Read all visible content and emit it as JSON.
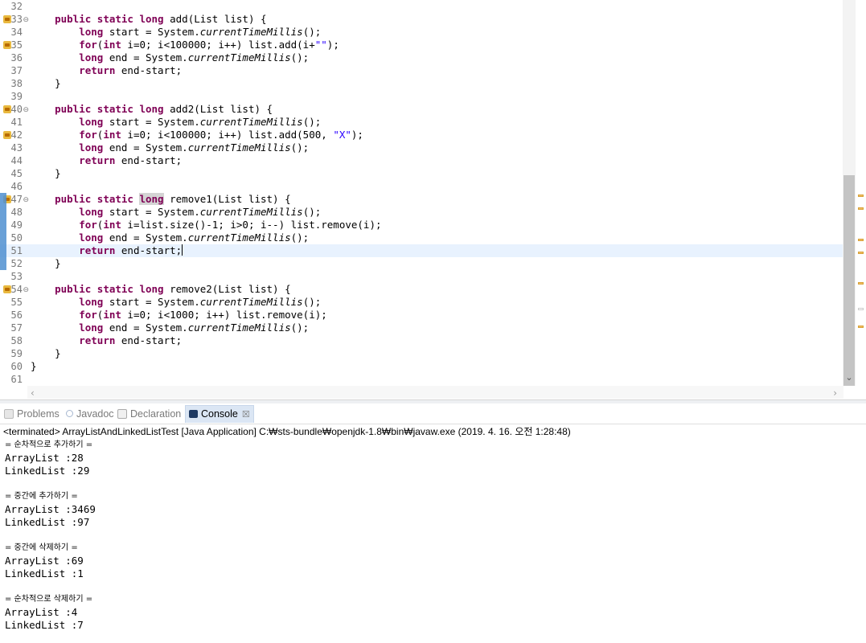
{
  "editor": {
    "lines": [
      {
        "num": "32",
        "seg": []
      },
      {
        "num": "33",
        "seg": [
          [
            "    ",
            ""
          ],
          [
            "public",
            "kw"
          ],
          [
            " ",
            ""
          ],
          [
            "static",
            "kw"
          ],
          [
            " ",
            ""
          ],
          [
            "long",
            "kw"
          ],
          [
            " add(List list) {",
            ""
          ]
        ]
      },
      {
        "num": "34",
        "seg": [
          [
            "        ",
            ""
          ],
          [
            "long",
            "kw"
          ],
          [
            " start = System.",
            ""
          ],
          [
            "currentTimeMillis",
            "ital"
          ],
          [
            "();",
            ""
          ]
        ]
      },
      {
        "num": "35",
        "seg": [
          [
            "        ",
            ""
          ],
          [
            "for",
            "kw"
          ],
          [
            "(",
            ""
          ],
          [
            "int",
            "kw"
          ],
          [
            " i=0; i<100000; i++) list.add(i+",
            ""
          ],
          [
            "\"\"",
            "str"
          ],
          [
            ");",
            ""
          ]
        ]
      },
      {
        "num": "36",
        "seg": [
          [
            "        ",
            ""
          ],
          [
            "long",
            "kw"
          ],
          [
            " end = System.",
            ""
          ],
          [
            "currentTimeMillis",
            "ital"
          ],
          [
            "();",
            ""
          ]
        ]
      },
      {
        "num": "37",
        "seg": [
          [
            "        ",
            ""
          ],
          [
            "return",
            "kw"
          ],
          [
            " end-start;",
            ""
          ]
        ]
      },
      {
        "num": "38",
        "seg": [
          [
            "    }",
            ""
          ]
        ]
      },
      {
        "num": "39",
        "seg": []
      },
      {
        "num": "40",
        "seg": [
          [
            "    ",
            ""
          ],
          [
            "public",
            "kw"
          ],
          [
            " ",
            ""
          ],
          [
            "static",
            "kw"
          ],
          [
            " ",
            ""
          ],
          [
            "long",
            "kw"
          ],
          [
            " add2(List list) {",
            ""
          ]
        ]
      },
      {
        "num": "41",
        "seg": [
          [
            "        ",
            ""
          ],
          [
            "long",
            "kw"
          ],
          [
            " start = System.",
            ""
          ],
          [
            "currentTimeMillis",
            "ital"
          ],
          [
            "();",
            ""
          ]
        ]
      },
      {
        "num": "42",
        "seg": [
          [
            "        ",
            ""
          ],
          [
            "for",
            "kw"
          ],
          [
            "(",
            ""
          ],
          [
            "int",
            "kw"
          ],
          [
            " i=0; i<100000; i++) list.add(500, ",
            ""
          ],
          [
            "\"X\"",
            "str"
          ],
          [
            ");",
            ""
          ]
        ]
      },
      {
        "num": "43",
        "seg": [
          [
            "        ",
            ""
          ],
          [
            "long",
            "kw"
          ],
          [
            " end = System.",
            ""
          ],
          [
            "currentTimeMillis",
            "ital"
          ],
          [
            "();",
            ""
          ]
        ]
      },
      {
        "num": "44",
        "seg": [
          [
            "        ",
            ""
          ],
          [
            "return",
            "kw"
          ],
          [
            " end-start;",
            ""
          ]
        ]
      },
      {
        "num": "45",
        "seg": [
          [
            "    }",
            ""
          ]
        ]
      },
      {
        "num": "46",
        "seg": []
      },
      {
        "num": "47",
        "seg": [
          [
            "    ",
            ""
          ],
          [
            "public",
            "kw"
          ],
          [
            " ",
            ""
          ],
          [
            "static",
            "kw"
          ],
          [
            " ",
            ""
          ],
          [
            "long",
            "kw hl"
          ],
          [
            " remove1(List list) {",
            ""
          ]
        ]
      },
      {
        "num": "48",
        "seg": [
          [
            "        ",
            ""
          ],
          [
            "long",
            "kw"
          ],
          [
            " start = System.",
            ""
          ],
          [
            "currentTimeMillis",
            "ital"
          ],
          [
            "();",
            ""
          ]
        ]
      },
      {
        "num": "49",
        "seg": [
          [
            "        ",
            ""
          ],
          [
            "for",
            "kw"
          ],
          [
            "(",
            ""
          ],
          [
            "int",
            "kw"
          ],
          [
            " i=list.size()-1; i>0; i--) list.remove(i);",
            ""
          ]
        ]
      },
      {
        "num": "50",
        "seg": [
          [
            "        ",
            ""
          ],
          [
            "long",
            "kw"
          ],
          [
            " end = System.",
            ""
          ],
          [
            "currentTimeMillis",
            "ital"
          ],
          [
            "();",
            ""
          ]
        ]
      },
      {
        "num": "51",
        "seg": [
          [
            "        ",
            ""
          ],
          [
            "return",
            "kw"
          ],
          [
            " end-start;",
            ""
          ]
        ]
      },
      {
        "num": "52",
        "seg": [
          [
            "    }",
            ""
          ]
        ]
      },
      {
        "num": "53",
        "seg": []
      },
      {
        "num": "54",
        "seg": [
          [
            "    ",
            ""
          ],
          [
            "public",
            "kw"
          ],
          [
            " ",
            ""
          ],
          [
            "static",
            "kw"
          ],
          [
            " ",
            ""
          ],
          [
            "long",
            "kw"
          ],
          [
            " remove2(List list) {",
            ""
          ]
        ]
      },
      {
        "num": "55",
        "seg": [
          [
            "        ",
            ""
          ],
          [
            "long",
            "kw"
          ],
          [
            " start = System.",
            ""
          ],
          [
            "currentTimeMillis",
            "ital"
          ],
          [
            "();",
            ""
          ]
        ]
      },
      {
        "num": "56",
        "seg": [
          [
            "        ",
            ""
          ],
          [
            "for",
            "kw"
          ],
          [
            "(",
            ""
          ],
          [
            "int",
            "kw"
          ],
          [
            " i=0; i<1000; i++) list.remove(i);",
            ""
          ]
        ]
      },
      {
        "num": "57",
        "seg": [
          [
            "        ",
            ""
          ],
          [
            "long",
            "kw"
          ],
          [
            " end = System.",
            ""
          ],
          [
            "currentTimeMillis",
            "ital"
          ],
          [
            "();",
            ""
          ]
        ]
      },
      {
        "num": "58",
        "seg": [
          [
            "        ",
            ""
          ],
          [
            "return",
            "kw"
          ],
          [
            " end-start;",
            ""
          ]
        ]
      },
      {
        "num": "59",
        "seg": [
          [
            "    }",
            ""
          ]
        ]
      },
      {
        "num": "60",
        "seg": [
          [
            "}",
            ""
          ]
        ]
      },
      {
        "num": "61",
        "seg": []
      }
    ],
    "warning_lines": [
      "33",
      "35",
      "40",
      "42",
      "47",
      "54"
    ],
    "fold_lines": [
      "33",
      "40",
      "47",
      "54"
    ],
    "current_line": "51"
  },
  "tabs": [
    {
      "label": "Problems",
      "icon": "problems-icon",
      "active": false
    },
    {
      "label": "Javadoc",
      "icon": "javadoc-icon",
      "active": false
    },
    {
      "label": "Declaration",
      "icon": "declaration-icon",
      "active": false
    },
    {
      "label": "Console",
      "icon": "console-icon",
      "active": true,
      "close": "☒"
    }
  ],
  "console": {
    "header": "<terminated> ArrayListAndLinkedListTest [Java Application] C:₩sts-bundle₩openjdk-1.8₩bin₩javaw.exe (2019. 4. 16. 오전 1:28:48)",
    "output": [
      {
        "text": "= 순차적으로 추가하기 =",
        "kr": true
      },
      {
        "text": "ArrayList :28"
      },
      {
        "text": "LinkedList :29"
      },
      {
        "text": ""
      },
      {
        "text": "= 중간에 추가하기 =",
        "kr": true
      },
      {
        "text": "ArrayList :3469"
      },
      {
        "text": "LinkedList :97"
      },
      {
        "text": ""
      },
      {
        "text": "= 중간에 삭제하기 =",
        "kr": true
      },
      {
        "text": "ArrayList :69"
      },
      {
        "text": "LinkedList :1"
      },
      {
        "text": ""
      },
      {
        "text": "= 순차적으로 삭제하기 =",
        "kr": true
      },
      {
        "text": "ArrayList :4"
      },
      {
        "text": "LinkedList :7"
      }
    ]
  },
  "colors": {
    "keyword": "#7f0055",
    "string": "#2a00ff",
    "current_line": "#e8f2fe",
    "active_tab": "#dbe6f4"
  }
}
